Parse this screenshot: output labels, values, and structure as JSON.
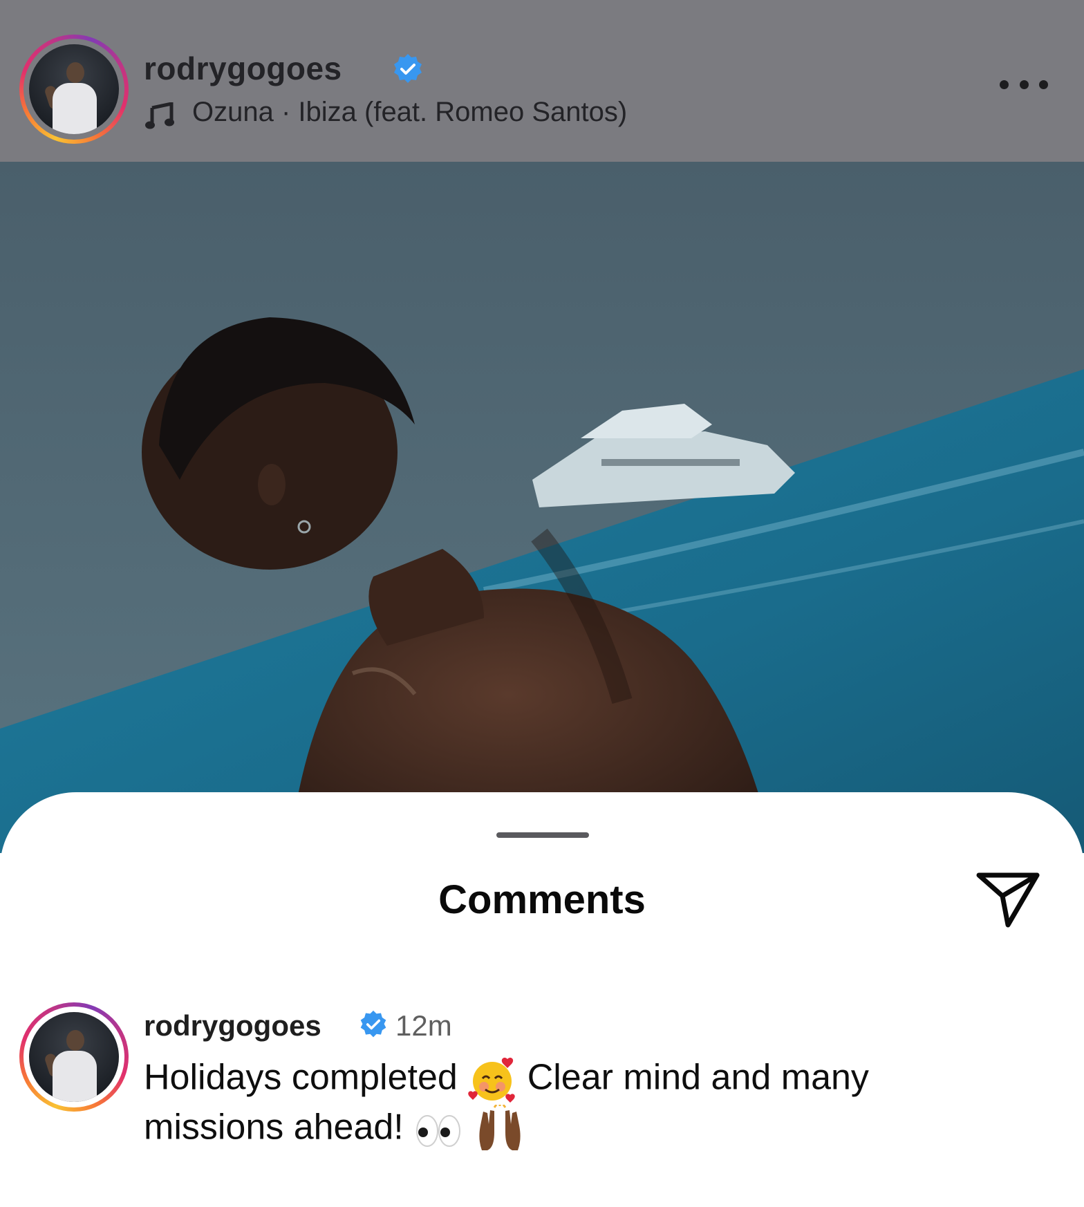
{
  "header": {
    "username": "rodrygogoes",
    "music_label": "Ozuna · Ibiza (feat. Romeo Santos)",
    "icons": [
      "music-note-icon",
      "verified-badge-icon",
      "more-options-icon"
    ]
  },
  "comments_sheet": {
    "title": "Comments",
    "share_icon": "send-icon"
  },
  "comment": {
    "username": "rodrygogoes",
    "time": "12m",
    "text_part1": "Holidays completed",
    "text_part2": "Clear mind and many",
    "text_part3": "missions ahead!"
  },
  "colors": {
    "verified_blue": "#3897f0",
    "header_overlay": "#7b7b80",
    "sea": "#1b6f91"
  }
}
